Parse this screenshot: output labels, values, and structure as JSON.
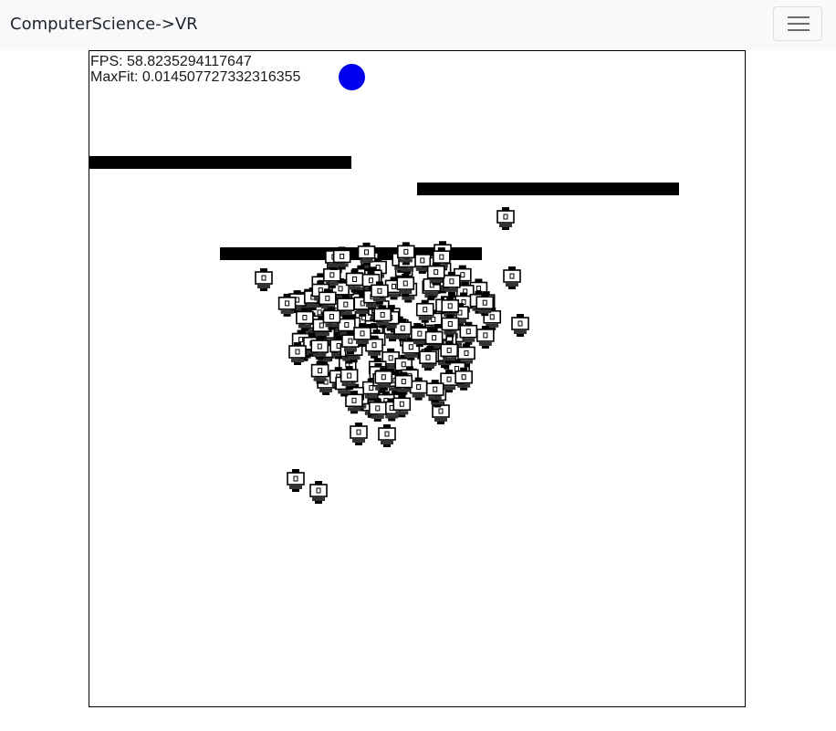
{
  "navbar": {
    "brand": "ComputerScience->VR",
    "toggler_icon": "hamburger-menu-icon"
  },
  "simulation": {
    "fps_label": "FPS:",
    "fps_value": "58.8235294117647",
    "maxfit_label": "MaxFit:",
    "maxfit_value": "0.014507727332316355",
    "target_color": "#0000ee",
    "obstacle_color": "#000000",
    "agent_icon": "robot-icon"
  }
}
